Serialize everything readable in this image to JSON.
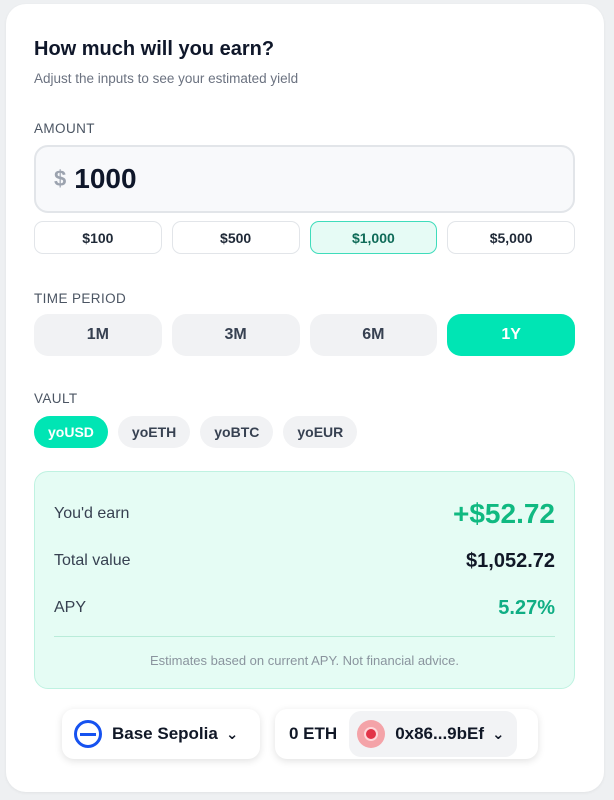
{
  "header": {
    "title": "How much will you earn?",
    "subtitle": "Adjust the inputs to see your estimated yield"
  },
  "amount": {
    "label": "AMOUNT",
    "currency_symbol": "$",
    "value": "1000",
    "presets": [
      "$100",
      "$500",
      "$1,000",
      "$5,000"
    ],
    "selected_preset": "$1,000"
  },
  "time_period": {
    "label": "TIME PERIOD",
    "options": [
      "1M",
      "3M",
      "6M",
      "1Y"
    ],
    "selected": "1Y"
  },
  "vault": {
    "label": "VAULT",
    "options": [
      "yoUSD",
      "yoETH",
      "yoBTC",
      "yoEUR"
    ],
    "selected": "yoUSD"
  },
  "results": {
    "earn_label": "You'd earn",
    "earn_value": "+$52.72",
    "total_label": "Total value",
    "total_value": "$1,052.72",
    "apy_label": "APY",
    "apy_value": "5.27%",
    "disclaimer": "Estimates based on current APY. Not financial advice."
  },
  "footer": {
    "network_label": "Base Sepolia",
    "network_icon": "base-network-icon",
    "balance": "0 ETH",
    "address": "0x86...9bEf",
    "avatar_icon": "wallet-avatar-icon"
  },
  "colors": {
    "accent": "#00e5b4",
    "earn_green": "#10b981",
    "results_bg": "#e5fcf4",
    "network_blue": "#1652f0"
  }
}
